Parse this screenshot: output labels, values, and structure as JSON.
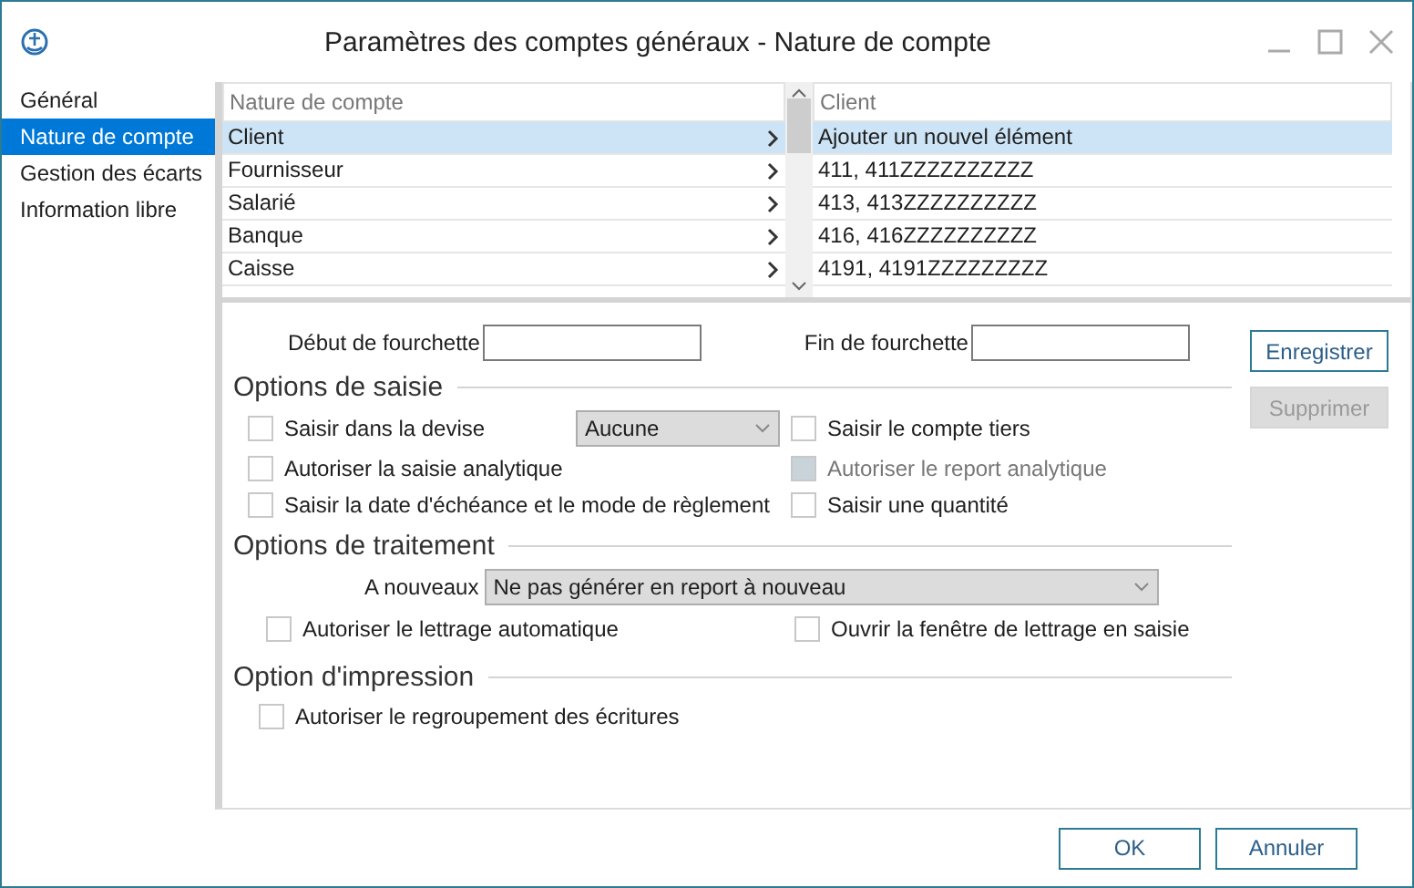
{
  "window": {
    "title": "Paramètres des comptes généraux - Nature de compte"
  },
  "sidebar": {
    "items": [
      {
        "label": "Général",
        "selected": false
      },
      {
        "label": "Nature de compte",
        "selected": true
      },
      {
        "label": "Gestion des écarts",
        "selected": false
      },
      {
        "label": "Information libre",
        "selected": false
      }
    ]
  },
  "nature_list": {
    "header": "Nature de compte",
    "rows": [
      {
        "label": "Client",
        "selected": true
      },
      {
        "label": "Fournisseur",
        "selected": false
      },
      {
        "label": "Salarié",
        "selected": false
      },
      {
        "label": "Banque",
        "selected": false
      },
      {
        "label": "Caisse",
        "selected": false
      }
    ]
  },
  "client_list": {
    "header": "Client",
    "rows": [
      {
        "label": "Ajouter un nouvel élément",
        "selected": true
      },
      {
        "label": "411, 411ZZZZZZZZZZ",
        "selected": false
      },
      {
        "label": "413, 413ZZZZZZZZZZ",
        "selected": false
      },
      {
        "label": "416, 416ZZZZZZZZZZ",
        "selected": false
      },
      {
        "label": "4191, 4191ZZZZZZZZZ",
        "selected": false
      }
    ]
  },
  "range": {
    "start_label": "Début de fourchette",
    "end_label": "Fin de fourchette"
  },
  "side_buttons": [
    {
      "label": "Enregistrer",
      "disabled": false
    },
    {
      "label": "Supprimer",
      "disabled": true
    }
  ],
  "saisie": {
    "title": "Options de saisie",
    "currency": "Aucune",
    "left": [
      {
        "label": "Saisir dans la devise",
        "checked": false,
        "disabled": false
      },
      {
        "label": "Autoriser la saisie analytique",
        "checked": false,
        "disabled": false
      },
      {
        "label": "Saisir la date d'échéance et le mode de règlement",
        "checked": false,
        "disabled": false
      }
    ],
    "right": [
      {
        "label": "Saisir le compte tiers",
        "checked": false,
        "disabled": false
      },
      {
        "label": "Autoriser le report analytique",
        "checked": false,
        "disabled": true
      },
      {
        "label": "Saisir une quantité",
        "checked": false,
        "disabled": false
      }
    ]
  },
  "traitement": {
    "title": "Options de traitement",
    "a_nouveaux_label": "A nouveaux",
    "a_nouveaux_value": "Ne pas générer en report à nouveau",
    "options": [
      {
        "label": "Autoriser le lettrage automatique",
        "checked": false,
        "disabled": false
      },
      {
        "label": "Ouvrir la fenêtre de lettrage en saisie",
        "checked": false,
        "disabled": false
      }
    ]
  },
  "impression": {
    "title": "Option d'impression",
    "options": [
      {
        "label": "Autoriser le regroupement des écritures",
        "checked": false,
        "disabled": false
      }
    ]
  },
  "footer_buttons": [
    "OK",
    "Annuler"
  ]
}
